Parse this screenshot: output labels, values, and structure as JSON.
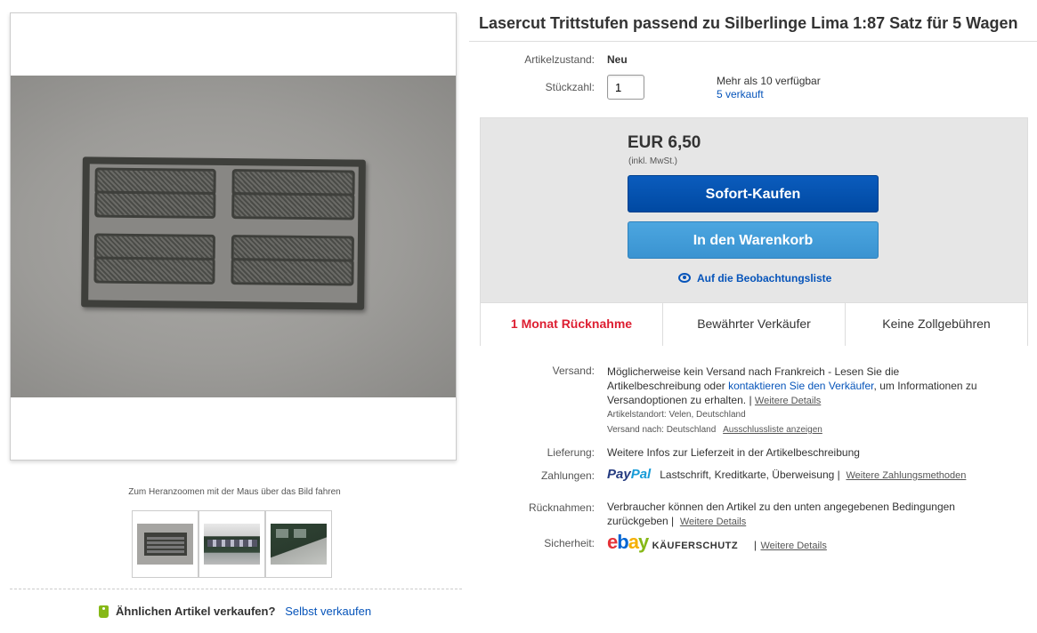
{
  "gallery": {
    "zoom_hint": "Zum Heranzoomen mit der Maus über das Bild fahren",
    "sell_similar_label": "Ähnlichen Artikel verkaufen?",
    "sell_link": "Selbst verkaufen"
  },
  "item": {
    "title": "Lasercut Trittstufen passend zu Silberlinge Lima 1:87 Satz für 5 Wagen",
    "condition_label": "Artikelzustand:",
    "condition_value": "Neu",
    "quantity_label": "Stückzahl:",
    "quantity_value": "1",
    "availability": "Mehr als 10 verfügbar",
    "sold_link": "5 verkauft"
  },
  "buybox": {
    "price": "EUR 6,50",
    "vat_note": "(inkl. MwSt.)",
    "buy_now": "Sofort-Kaufen",
    "add_to_cart": "In den Warenkorb",
    "watchlist": "Auf die Beobachtungsliste",
    "badges": [
      "1 Monat Rücknahme",
      "Bewährter Verkäufer",
      "Keine Zollgebühren"
    ]
  },
  "details": {
    "shipping_label": "Versand:",
    "shipping_text_1": "Möglicherweise kein Versand nach Frankreich - Lesen Sie die",
    "shipping_text_2a": "Artikelbeschreibung oder ",
    "shipping_contact_link": "kontaktieren Sie den Verkäufer",
    "shipping_text_2b": ", um Informationen zu",
    "shipping_text_3": "Versandoptionen zu erhalten. |",
    "shipping_more": "Weitere Details",
    "item_location": "Artikelstandort: Velen, Deutschland",
    "ships_to": "Versand nach: Deutschland",
    "exclusion_link": "Ausschlussliste anzeigen",
    "delivery_label": "Lieferung:",
    "delivery_text": "Weitere Infos zur Lieferzeit in der Artikelbeschreibung",
    "payment_label": "Zahlungen:",
    "paypal_1": "Pay",
    "paypal_2": "Pal",
    "payment_methods": "Lastschrift,  Kreditkarte,  Überweisung  |",
    "payment_more": "Weitere Zahlungsmethoden",
    "returns_label": "Rücknahmen:",
    "returns_text_1": "Verbraucher können den Artikel zu den unten angegebenen Bedingungen",
    "returns_text_2": "zurückgeben |",
    "returns_more": "Weitere Details",
    "security_label": "Sicherheit:",
    "ebay_e": "e",
    "ebay_b": "b",
    "ebay_a": "a",
    "ebay_y": "y",
    "buyer_protection": "KÄUFERSCHUTZ",
    "security_more": "Weitere Details"
  }
}
